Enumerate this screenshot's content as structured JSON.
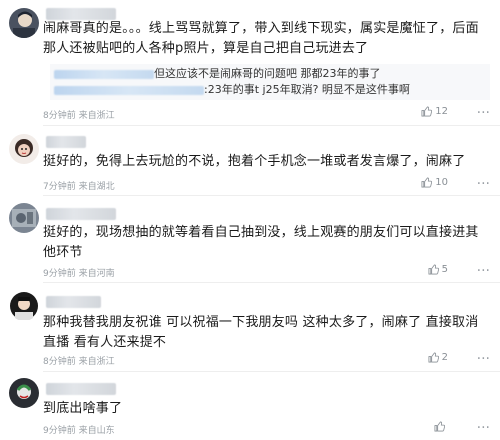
{
  "comments": [
    {
      "text": "闹麻哥真的是。。。线上骂骂就算了，带入到线下现实，属实是魔怔了，后面那人还被贴吧的人各种p照片，算是自己把自己玩进去了",
      "replies": [
        {
          "text": "但这应该不是闹麻哥的问题吧 那都23年的事了"
        },
        {
          "text": ":23年的事t j25年取消? 明显不是这件事啊"
        }
      ],
      "time": "8分钟前",
      "location": "来自浙江",
      "likes": "12"
    },
    {
      "text": "挺好的，免得上去玩尬的不说，抱着个手机念一堆或者发言爆了，闹麻了",
      "time": "7分钟前",
      "location": "来自湖北",
      "likes": "10"
    },
    {
      "text": "挺好的，现场想抽的就等着看自己抽到没，线上观赛的朋友们可以直接进其他环节",
      "time": "9分钟前",
      "location": "来自河南",
      "likes": "5"
    },
    {
      "text": "那种我替我朋友祝谁 可以祝福一下我朋友吗 这种太多了，闹麻了 直接取消直播 看有人还来提不",
      "time": "8分钟前",
      "location": "来自浙江",
      "likes": "2"
    },
    {
      "text": "到底出啥事了",
      "time": "9分钟前",
      "location": "来自山东",
      "likes": ""
    }
  ],
  "icons": {
    "like": "thumbs-up-icon",
    "more": "more-options-icon"
  },
  "colors": {
    "meta": "#9aa0a6",
    "text": "#1a1a1a",
    "quote_bg": "#f7f8fa"
  }
}
